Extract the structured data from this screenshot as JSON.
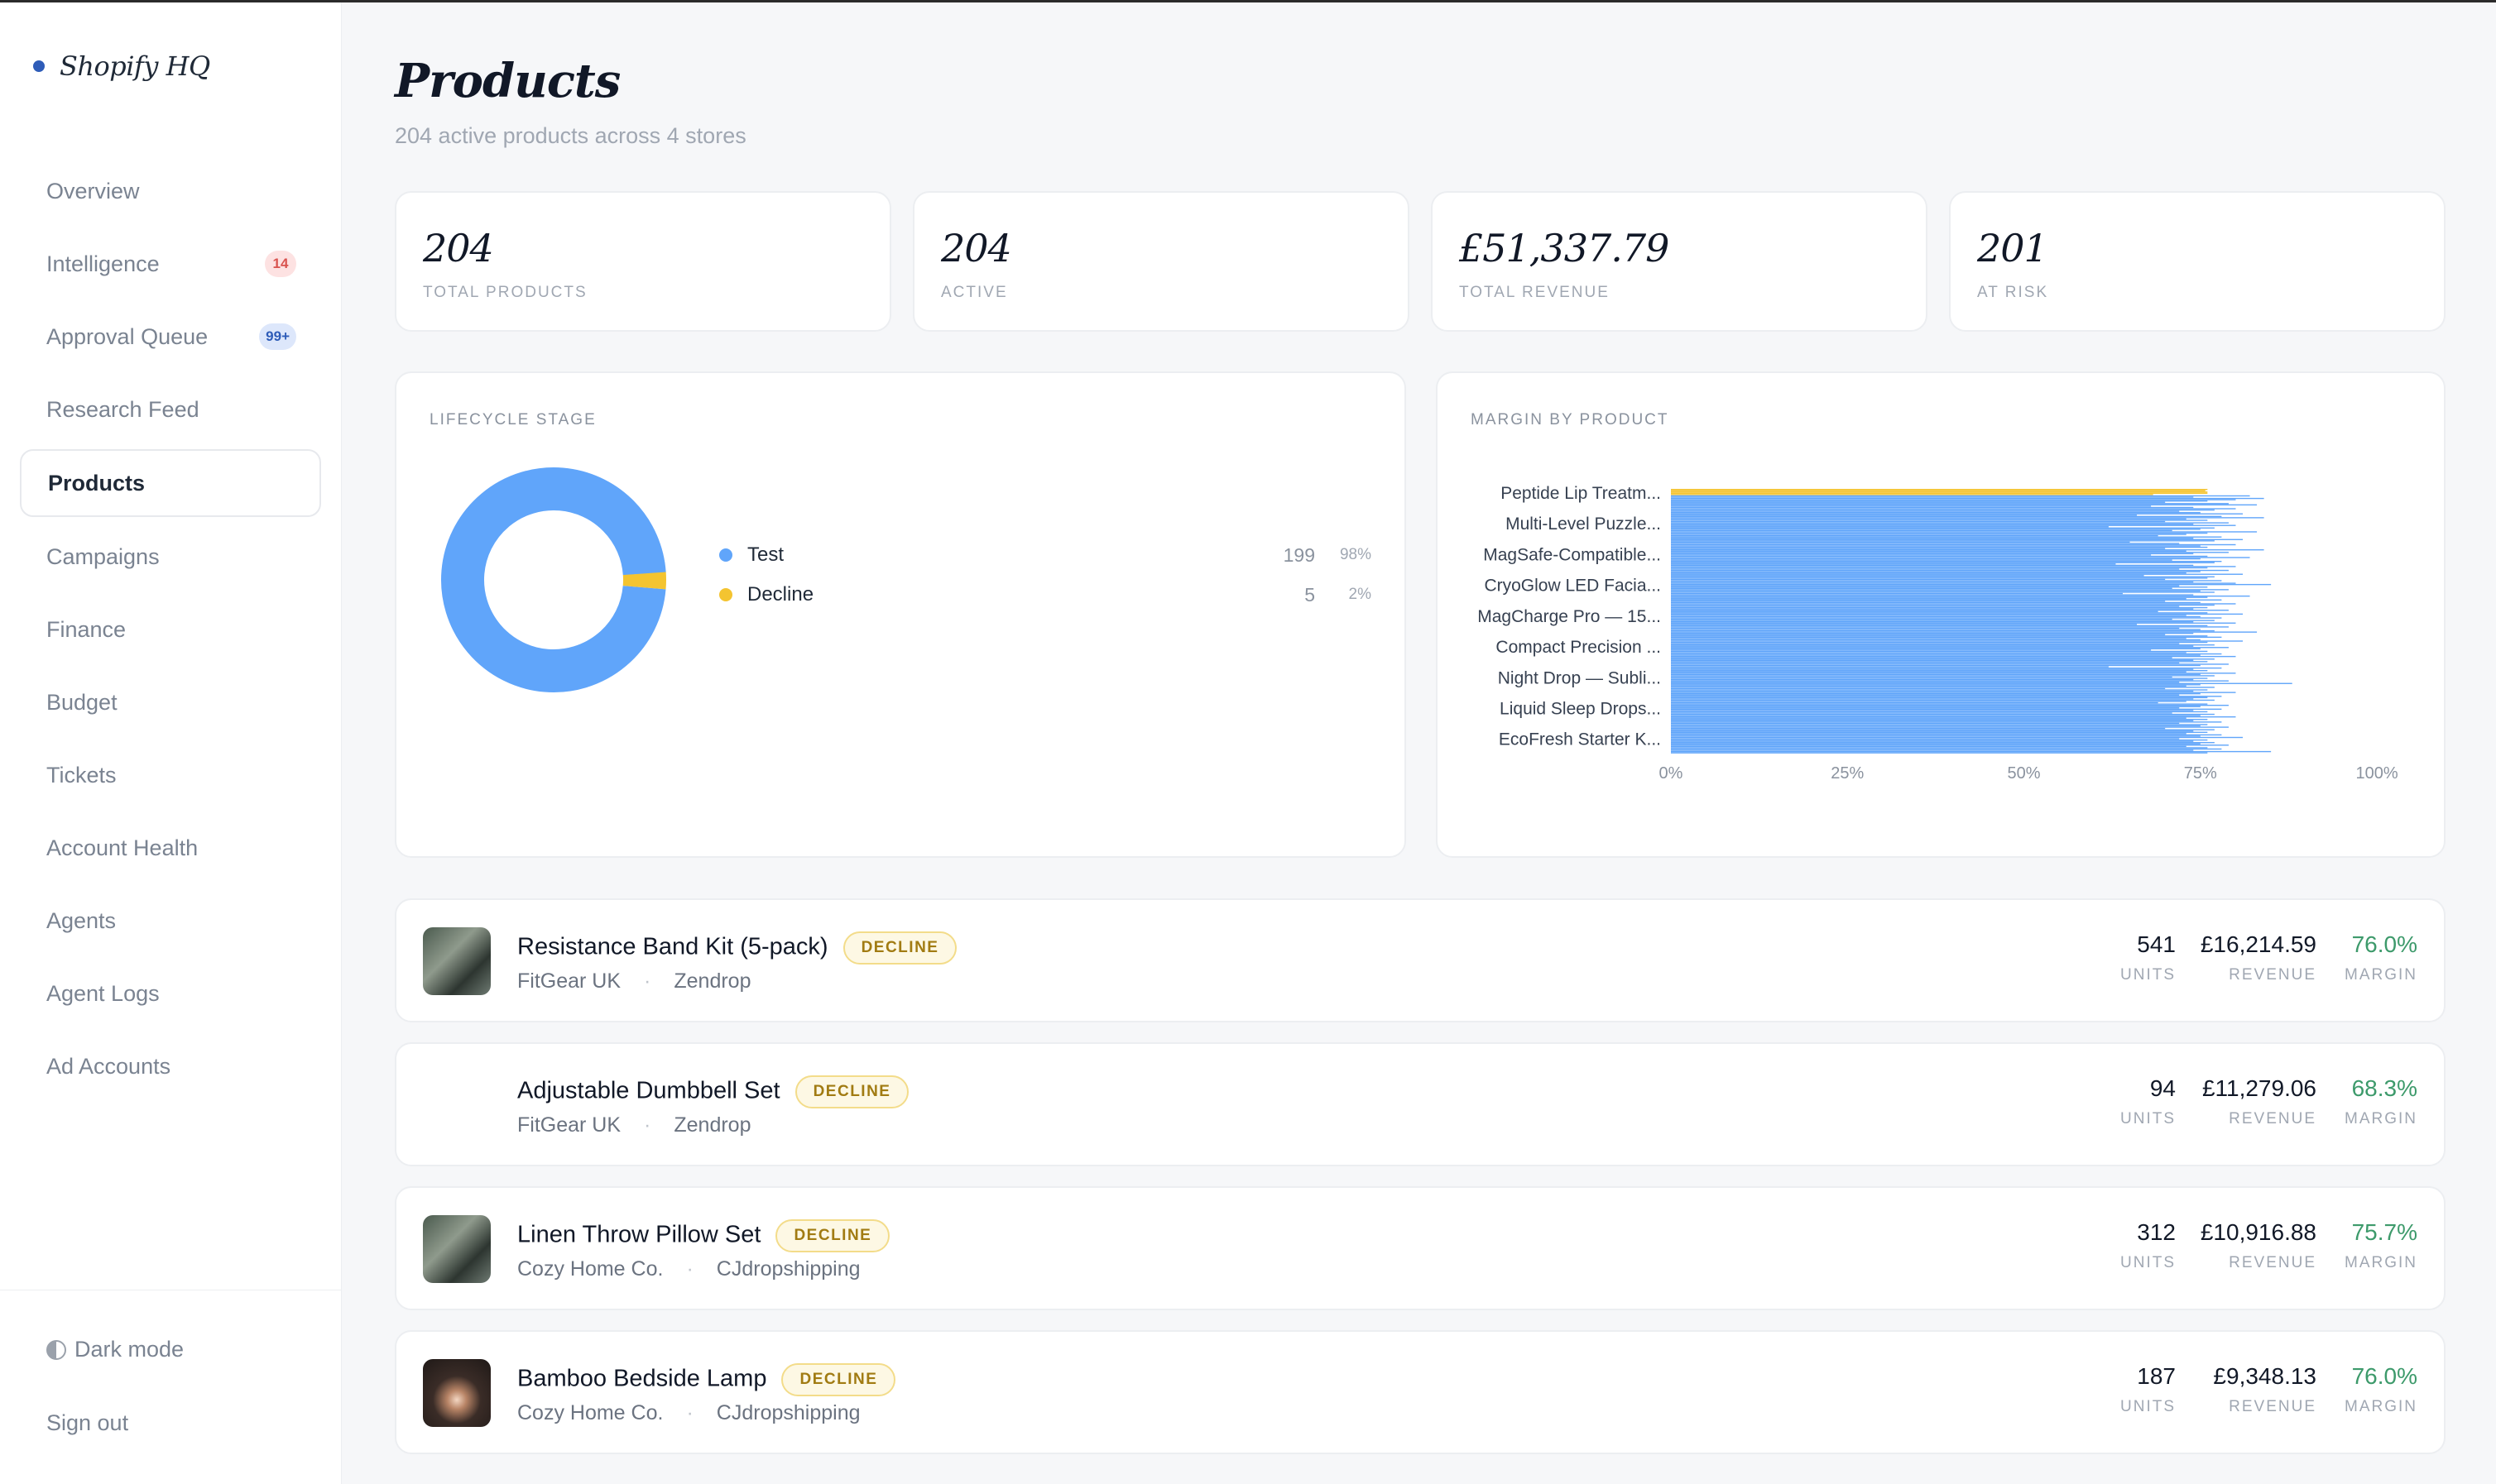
{
  "brand": {
    "name": "Shopify HQ"
  },
  "sidebar": {
    "items": [
      {
        "label": "Overview",
        "badge": ""
      },
      {
        "label": "Intelligence",
        "badge": "14"
      },
      {
        "label": "Approval Queue",
        "badge": "99+"
      },
      {
        "label": "Research Feed",
        "badge": ""
      },
      {
        "label": "Products",
        "badge": "",
        "active": true
      },
      {
        "label": "Campaigns",
        "badge": ""
      },
      {
        "label": "Finance",
        "badge": ""
      },
      {
        "label": "Budget",
        "badge": ""
      },
      {
        "label": "Tickets",
        "badge": ""
      },
      {
        "label": "Account Health",
        "badge": ""
      },
      {
        "label": "Agents",
        "badge": ""
      },
      {
        "label": "Agent Logs",
        "badge": ""
      },
      {
        "label": "Ad Accounts",
        "badge": ""
      }
    ],
    "dark_mode_label": "Dark mode",
    "sign_out_label": "Sign out"
  },
  "header": {
    "title": "Products",
    "subtitle": "204 active products across 4 stores"
  },
  "stats": [
    {
      "value": "204",
      "label": "TOTAL PRODUCTS"
    },
    {
      "value": "204",
      "label": "ACTIVE"
    },
    {
      "value": "£51,337.79",
      "label": "TOTAL REVENUE"
    },
    {
      "value": "201",
      "label": "AT RISK"
    }
  ],
  "lifecycle": {
    "title": "LIFECYCLE STAGE",
    "rows": [
      {
        "name": "Test",
        "count": "199",
        "pct": "98%",
        "color": "#60a5fa"
      },
      {
        "name": "Decline",
        "count": "5",
        "pct": "2%",
        "color": "#f4c430"
      }
    ]
  },
  "margin_panel": {
    "title": "MARGIN BY PRODUCT"
  },
  "chart_data": [
    {
      "type": "pie",
      "title": "",
      "categories": [
        "Test",
        "Decline"
      ],
      "values": [
        199,
        5
      ],
      "colors": [
        "#60a5fa",
        "#f4c430"
      ],
      "donut": true
    },
    {
      "type": "bar",
      "orientation": "horizontal",
      "title": "",
      "xlim": [
        0,
        100
      ],
      "xticks": [
        "0%",
        "25%",
        "50%",
        "75%",
        "100%"
      ],
      "ytick_labels": [
        "Peptide Lip Treatm...",
        "Multi-Level Puzzle...",
        "MagSafe-Compatible...",
        "CryoGlow LED Facia...",
        "MagCharge Pro — 15...",
        "Compact Precision ...",
        "Night Drop — Subli...",
        "Liquid Sleep Drops...",
        "EcoFresh Starter K..."
      ],
      "series": [
        {
          "color": "#f4c430",
          "values": [
            76.0,
            75.7,
            76.0,
            76.0,
            68.3
          ]
        },
        {
          "color": "#60a5fa",
          "values": [
            82,
            74,
            84,
            80,
            76,
            70,
            79,
            83,
            68,
            74,
            80,
            77,
            72,
            75,
            81,
            66,
            78,
            84,
            73,
            76,
            70,
            79,
            74,
            80,
            62,
            77,
            75,
            71,
            83,
            76,
            73,
            69,
            78,
            74,
            81,
            77,
            65,
            72,
            80,
            75,
            76,
            70,
            84,
            73,
            79,
            74,
            68,
            76,
            82,
            75,
            71,
            78,
            77,
            63,
            74,
            80,
            76,
            72,
            79,
            75,
            73,
            81,
            67,
            77,
            76,
            70,
            78,
            74,
            80,
            85,
            72,
            76,
            71,
            79,
            75,
            77,
            64,
            74,
            82,
            76,
            73,
            78,
            70,
            75,
            80,
            77,
            72,
            76,
            74,
            79,
            69,
            76,
            81,
            73,
            75,
            78,
            71,
            77,
            74,
            80,
            66,
            76,
            79,
            72,
            75,
            77,
            83,
            74,
            70,
            76,
            78,
            73,
            75,
            81,
            76,
            72,
            77,
            74,
            79,
            75,
            68,
            76,
            73,
            78,
            75,
            80,
            71,
            77,
            74,
            76,
            72,
            79,
            75,
            62,
            78,
            74,
            76,
            73,
            80,
            75,
            77,
            71,
            76,
            74,
            79,
            72,
            88,
            75,
            73,
            77,
            70,
            76,
            74,
            80,
            75,
            72,
            78,
            76,
            74,
            77,
            73,
            69,
            76,
            79,
            75,
            72,
            78,
            74,
            76,
            71,
            77,
            75,
            80,
            73,
            76,
            74,
            78,
            72,
            76,
            75,
            79,
            70,
            77,
            74,
            76,
            73,
            78,
            75,
            81,
            72,
            76,
            74,
            77,
            75,
            79,
            73,
            76,
            78,
            74,
            85,
            76
          ]
        }
      ]
    }
  ],
  "products": [
    {
      "name": "Resistance Band Kit (5-pack)",
      "badge": "DECLINE",
      "store": "FitGear UK",
      "supplier": "Zendrop",
      "units": "541",
      "revenue": "£16,214.59",
      "margin": "76.0%",
      "thumb": "photo"
    },
    {
      "name": "Adjustable Dumbbell Set",
      "badge": "DECLINE",
      "store": "FitGear UK",
      "supplier": "Zendrop",
      "units": "94",
      "revenue": "£11,279.06",
      "margin": "68.3%",
      "thumb": "none"
    },
    {
      "name": "Linen Throw Pillow Set",
      "badge": "DECLINE",
      "store": "Cozy Home Co.",
      "supplier": "CJdropshipping",
      "units": "312",
      "revenue": "£10,916.88",
      "margin": "75.7%",
      "thumb": "photo"
    },
    {
      "name": "Bamboo Bedside Lamp",
      "badge": "DECLINE",
      "store": "Cozy Home Co.",
      "supplier": "CJdropshipping",
      "units": "187",
      "revenue": "£9,348.13",
      "margin": "76.0%",
      "thumb": "lamp"
    }
  ],
  "metric_labels": {
    "units": "UNITS",
    "revenue": "REVENUE",
    "margin": "MARGIN"
  },
  "separator": "·"
}
